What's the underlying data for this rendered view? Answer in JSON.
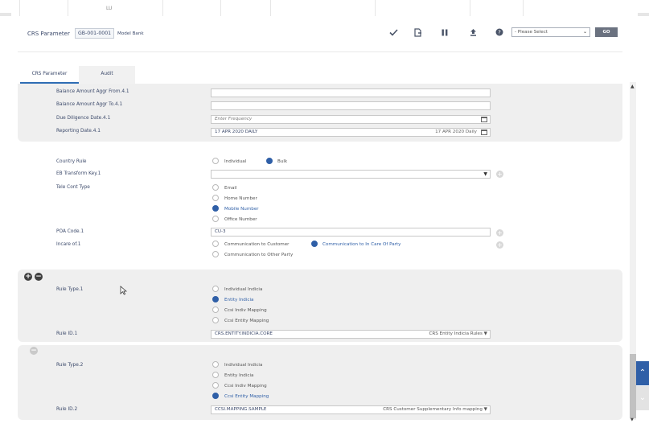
{
  "top": {
    "fragment": "LU"
  },
  "header": {
    "title": "CRS Parameter",
    "app_id": "GB-001-0001",
    "bank": "Model Bank",
    "select": "- Please Select",
    "go": "GO"
  },
  "tabs": [
    {
      "label": "CRS Parameter"
    },
    {
      "label": "Audit"
    }
  ],
  "section1": {
    "balance_from_label": "Balance Amount Aggr From.4.1",
    "balance_to_label": "Balance Amount Aggr To.4.1",
    "due_label": "Due Diligence Date.4.1",
    "due_placeholder": "Enter Frequency",
    "reporting_label": "Reporting Date.4.1",
    "reporting_value": "17 APR 2020 DAILY",
    "reporting_right": "17 APR 2020 Daily"
  },
  "section2": {
    "country_rule_label": "Country Rule",
    "country_rule_options": [
      "Individual",
      "Bulk"
    ],
    "eb_label": "EB Transform Key.1",
    "tele_label": "Tele Cont Type",
    "tele_options": [
      "Email",
      "Home Number",
      "Mobile Number",
      "Office Number"
    ],
    "poa_label": "POA Code.1",
    "poa_value": "CU-3",
    "incare_label": "Incare of.1",
    "incare_options": [
      "Communication to Customer",
      "Communication to In Care Of Party",
      "Communication to Other Party"
    ]
  },
  "rule1": {
    "type_label": "Rule Type.1",
    "options": [
      "Individual Indicia",
      "Entity Indicia",
      "Ccsi Indiv Mapping",
      "Ccsi Entity Mapping"
    ],
    "id_label": "Rule ID.1",
    "id_value": "CRS.ENTITY.INDICIA.CORE",
    "id_right": "CRS Entity Indicia Rules"
  },
  "rule2": {
    "type_label": "Rule Type.2",
    "options": [
      "Individual Indicia",
      "Entity Indicia",
      "Ccsi Indiv Mapping",
      "Ccsi Entity Mapping"
    ],
    "id_label": "Rule ID.2",
    "id_value": "CCSI.MAPPING.SAMPLE",
    "id_right": "CRS Customer Supplementary Info mapping"
  },
  "colors": {
    "accent": "#2f5fa7",
    "tab_underline": "#2e6db4",
    "side_button": "#2f5fa7"
  }
}
